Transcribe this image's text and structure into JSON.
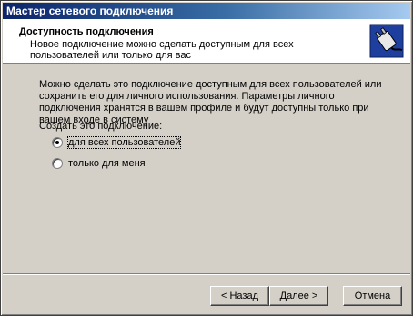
{
  "window": {
    "title": "Мастер сетевого подключения"
  },
  "header": {
    "title": "Доступность подключения",
    "subtitle": "Новое подключение можно сделать доступным для всех пользователей или только для вас"
  },
  "body": {
    "description": "Можно сделать это подключение доступным для всех пользователей или сохранить его для личного использования. Параметры личного подключения хранятся в вашем профиле и будут доступны только при вашем входе в систему",
    "create_label": "Создать это подключение:",
    "options": [
      {
        "label": "для всех пользователей",
        "selected": true
      },
      {
        "label": "только для меня",
        "selected": false
      }
    ]
  },
  "buttons": {
    "back": "< Назад",
    "next": "Далее >",
    "cancel": "Отмена"
  },
  "icons": {
    "header_icon": "network-plug-icon"
  }
}
